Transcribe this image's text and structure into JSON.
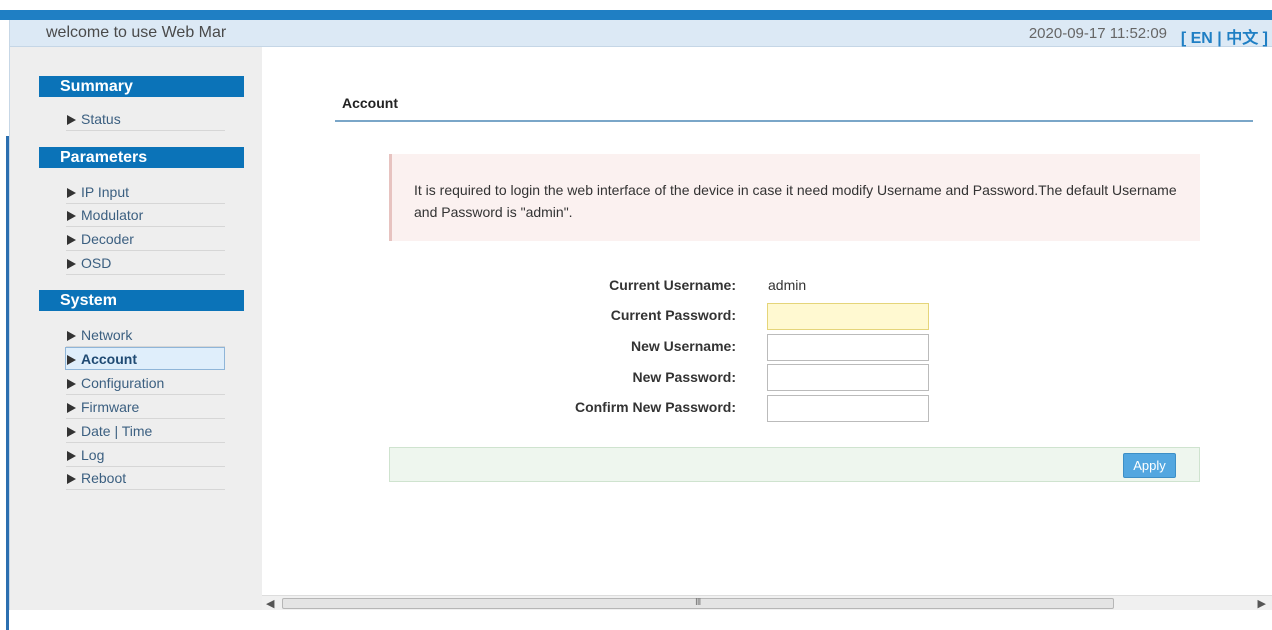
{
  "header": {
    "welcome": "welcome to use Web Mar",
    "datetime": "2020-09-17 11:52:09",
    "lang_open": "[",
    "lang_en": "EN",
    "lang_sep": " | ",
    "lang_zh": "中文",
    "lang_close": "]"
  },
  "sidebar": {
    "summary": {
      "title": "Summary",
      "items": [
        {
          "label": "Status"
        }
      ]
    },
    "parameters": {
      "title": "Parameters",
      "items": [
        {
          "label": "IP Input"
        },
        {
          "label": "Modulator"
        },
        {
          "label": "Decoder"
        },
        {
          "label": "OSD"
        }
      ]
    },
    "system": {
      "title": "System",
      "items": [
        {
          "label": "Network"
        },
        {
          "label": "Account"
        },
        {
          "label": "Configuration"
        },
        {
          "label": "Firmware"
        },
        {
          "label": "Date | Time"
        },
        {
          "label": "Log"
        },
        {
          "label": "Reboot"
        }
      ]
    }
  },
  "main": {
    "title": "Account",
    "notice": "It is required to login the web interface of the device in case it need modify Username and Password.The default Username and Password is \"admin\".",
    "form": {
      "current_username_label": "Current Username:",
      "current_username_value": "admin",
      "current_password_label": "Current Password:",
      "new_username_label": "New Username:",
      "new_password_label": "New Password:",
      "confirm_password_label": "Confirm New Password:"
    },
    "apply_label": "Apply"
  },
  "scrollbar": {
    "grip": "III"
  },
  "colors": {
    "accent": "#0b73b8",
    "header_bg": "#dce9f5",
    "notice_bg": "#fbf1f0",
    "apply_bg": "#53a7e0"
  }
}
